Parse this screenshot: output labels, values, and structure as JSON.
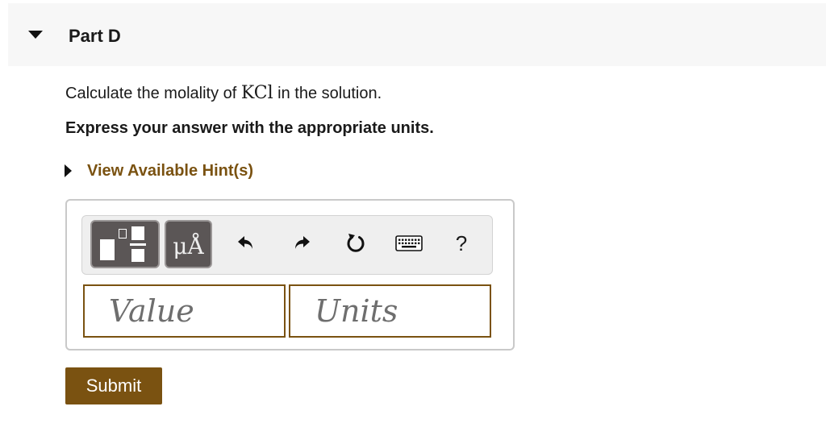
{
  "part": {
    "title": "Part D"
  },
  "question": {
    "prefix": "Calculate the molality of ",
    "chemical": "KCl",
    "suffix": " in the solution."
  },
  "instruction": "Express your answer with the appropriate units.",
  "hint": {
    "label": "View Available Hint(s)"
  },
  "toolbar": {
    "units_symbol": "μÅ",
    "help_label": "?",
    "icons": [
      "templates-icon",
      "units-icon",
      "undo-icon",
      "redo-icon",
      "reset-icon",
      "keyboard-icon",
      "help-icon"
    ]
  },
  "answer": {
    "value_placeholder": "Value",
    "units_placeholder": "Units"
  },
  "submit_label": "Submit",
  "colors": {
    "accent": "#7a5211",
    "toolbar_button": "#5b5656",
    "header_bg": "#f7f7f7"
  }
}
